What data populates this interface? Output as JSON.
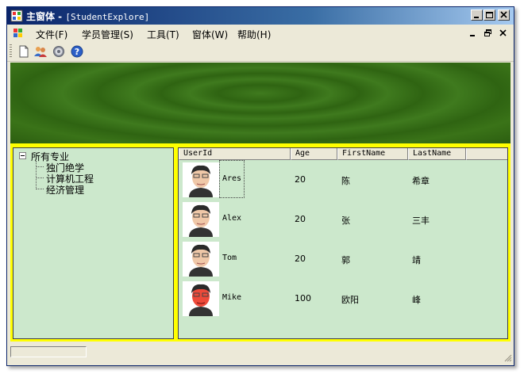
{
  "window": {
    "title": "主窗体 - ",
    "subtitle": "[StudentExplore]",
    "controls": [
      "minimize-icon",
      "maximize-icon",
      "close-icon"
    ]
  },
  "menu": {
    "items": [
      "文件(F)",
      "学员管理(S)",
      "工具(T)",
      "窗体(W)",
      "帮助(H)"
    ],
    "mdi_controls": [
      "minimize-icon",
      "restore-icon",
      "close-icon"
    ]
  },
  "toolbar": {
    "buttons": [
      "new-document-icon",
      "users-icon",
      "settings-gear-icon",
      "help-icon"
    ]
  },
  "colors": {
    "splitter": "#ffff00",
    "panel_background": "#cce8cc",
    "banner": "#2f6412",
    "title_gradient_start": "#0a246a"
  },
  "tree": {
    "root": "所有专业",
    "children": [
      "独门绝学",
      "计算机工程",
      "经济管理"
    ]
  },
  "grid": {
    "columns": [
      "UserId",
      "Age",
      "FirstName",
      "LastName"
    ],
    "rows": [
      {
        "user_id": "Ares",
        "age": "20",
        "first_name": "陈",
        "last_name": "希章"
      },
      {
        "user_id": "Alex",
        "age": "20",
        "first_name": "张",
        "last_name": "三丰"
      },
      {
        "user_id": "Tom",
        "age": "20",
        "first_name": "郭",
        "last_name": "靖"
      },
      {
        "user_id": "Mike",
        "age": "100",
        "first_name": "欧阳",
        "last_name": "峰"
      }
    ]
  },
  "statusbar": {
    "text": ""
  }
}
